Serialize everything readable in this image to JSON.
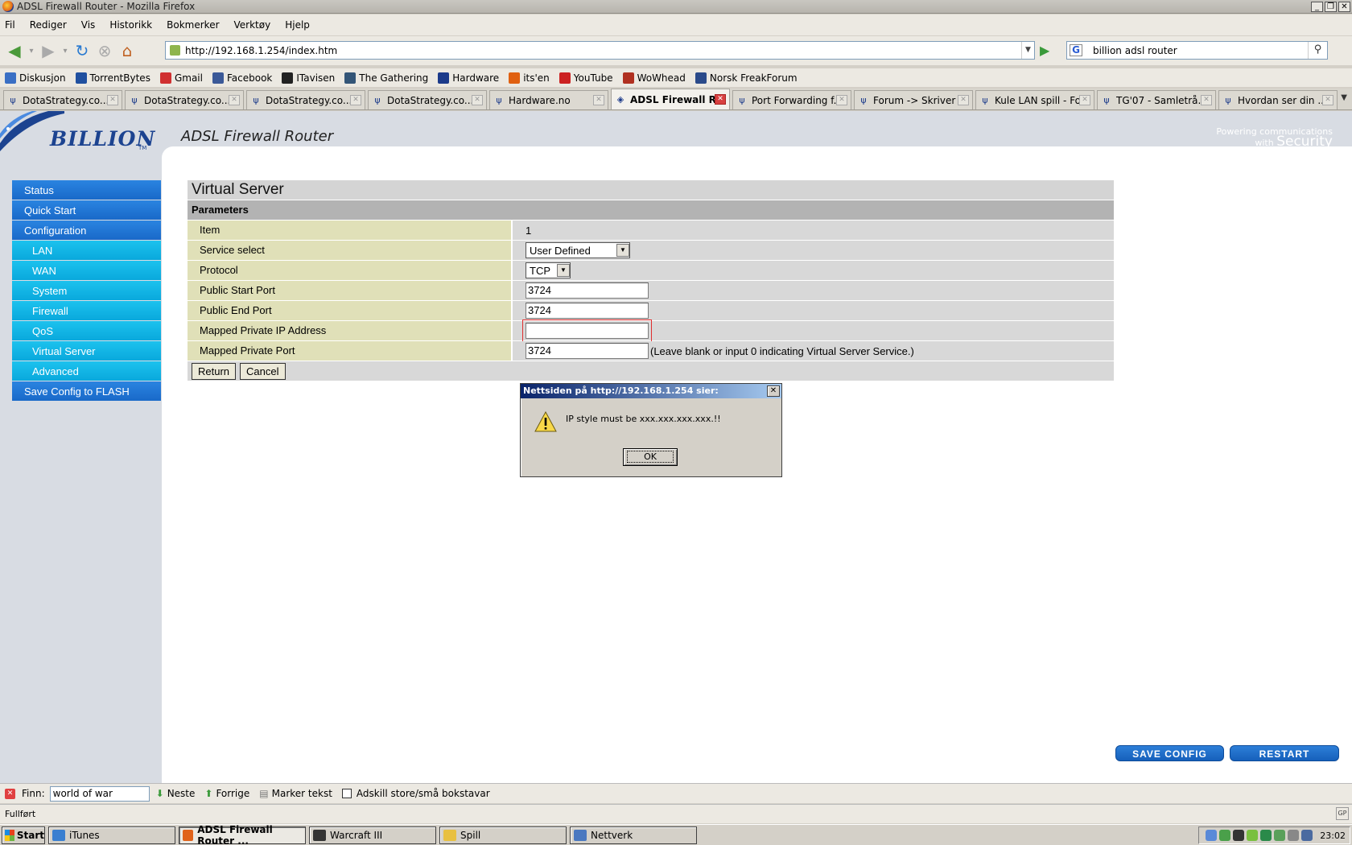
{
  "window": {
    "title": "ADSL Firewall Router - Mozilla Firefox"
  },
  "menu": [
    "Fil",
    "Rediger",
    "Vis",
    "Historikk",
    "Bokmerker",
    "Verktøy",
    "Hjelp"
  ],
  "toolbar": {
    "url": "http://192.168.1.254/index.htm",
    "search_value": "billion adsl router"
  },
  "bookmarks": [
    {
      "label": "Diskusjon",
      "color": "#3a6fc4"
    },
    {
      "label": "TorrentBytes",
      "color": "#2050a0"
    },
    {
      "label": "Gmail",
      "color": "#d03030"
    },
    {
      "label": "Facebook",
      "color": "#3b5998"
    },
    {
      "label": "ITavisen",
      "color": "#222222"
    },
    {
      "label": "The Gathering",
      "color": "#335577"
    },
    {
      "label": "Hardware",
      "color": "#1b3a8a"
    },
    {
      "label": "its'en",
      "color": "#e06010"
    },
    {
      "label": "YouTube",
      "color": "#cc2222"
    },
    {
      "label": "WoWhead",
      "color": "#b03020"
    },
    {
      "label": "Norsk FreakForum",
      "color": "#2a4a8a"
    }
  ],
  "tabs": [
    {
      "label": "DotaStrategy.co...",
      "active": false
    },
    {
      "label": "DotaStrategy.co...",
      "active": false
    },
    {
      "label": "DotaStrategy.co...",
      "active": false
    },
    {
      "label": "DotaStrategy.co...",
      "active": false
    },
    {
      "label": "Hardware.no",
      "active": false
    },
    {
      "label": "ADSL Firewall R...",
      "active": true
    },
    {
      "label": "Port Forwarding f...",
      "active": false
    },
    {
      "label": "Forum -> Skriver ...",
      "active": false
    },
    {
      "label": "Kule LAN spill - Fo...",
      "active": false
    },
    {
      "label": "TG'07 - Samletrå...",
      "active": false
    },
    {
      "label": "Hvordan ser din ...",
      "active": false
    }
  ],
  "router": {
    "brand": "BILLION",
    "brand_tm": "TM",
    "product": "ADSL Firewall Router",
    "tagline_top": "Powering communications",
    "tagline_mid": "with",
    "tagline_bottom": "Security"
  },
  "sidebar": [
    {
      "label": "Status",
      "level": "main"
    },
    {
      "label": "Quick Start",
      "level": "main"
    },
    {
      "label": "Configuration",
      "level": "main"
    },
    {
      "label": "LAN",
      "level": "sub"
    },
    {
      "label": "WAN",
      "level": "sub"
    },
    {
      "label": "System",
      "level": "sub"
    },
    {
      "label": "Firewall",
      "level": "sub"
    },
    {
      "label": "QoS",
      "level": "sub"
    },
    {
      "label": "Virtual Server",
      "level": "sub"
    },
    {
      "label": "Advanced",
      "level": "sub"
    },
    {
      "label": "Save Config to FLASH",
      "level": "main"
    }
  ],
  "virtual_server": {
    "title": "Virtual Server",
    "section": "Parameters",
    "item_label": "Item",
    "item_value": "1",
    "service_label": "Service select",
    "service_value": "User Defined",
    "protocol_label": "Protocol",
    "protocol_value": "TCP",
    "public_start_label": "Public Start Port",
    "public_start_value": "3724",
    "public_end_label": "Public End Port",
    "public_end_value": "3724",
    "mapped_ip_label": "Mapped Private IP Address",
    "mapped_ip_value": "",
    "mapped_port_label": "Mapped Private Port",
    "mapped_port_value": "3724",
    "mapped_port_hint": "(Leave blank or input 0 indicating Virtual Server Service.)",
    "return_label": "Return",
    "cancel_label": "Cancel"
  },
  "bottom_buttons": {
    "save_config": "SAVE CONFIG",
    "restart": "RESTART"
  },
  "dialog": {
    "title": "Nettsiden på http://192.168.1.254 sier:",
    "message": "IP style must be xxx.xxx.xxx.xxx.!!",
    "ok": "OK"
  },
  "findbar": {
    "label": "Finn:",
    "value": "world of war",
    "next": "Neste",
    "prev": "Forrige",
    "highlight": "Marker tekst",
    "match_case": "Adskill store/små bokstavar"
  },
  "status": "Fullført",
  "taskbar": {
    "start": "Start",
    "items": [
      {
        "label": "iTunes",
        "active": false,
        "color": "#3a7fd0"
      },
      {
        "label": "ADSL Firewall Router ...",
        "active": true,
        "color": "#e0621a"
      },
      {
        "label": "Warcraft III",
        "active": false,
        "color": "#333333"
      },
      {
        "label": "Spill",
        "active": false,
        "color": "#e8c040"
      },
      {
        "label": "Nettverk",
        "active": false,
        "color": "#4a78c0"
      }
    ],
    "clock": "23:02"
  }
}
